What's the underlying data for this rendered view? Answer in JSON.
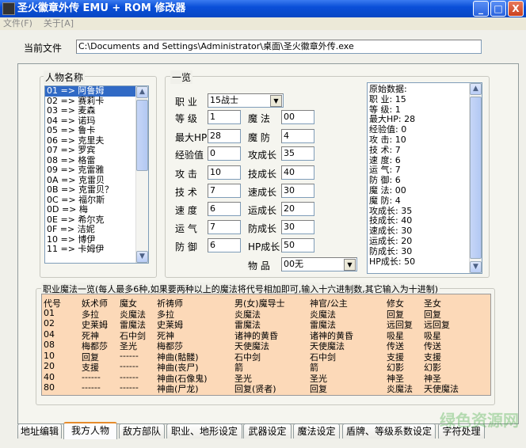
{
  "window": {
    "title": "圣火徽章外传 EMU + ROM 修改器",
    "minimize": "_",
    "maximize": "□",
    "close": "X"
  },
  "menu": [
    "文件(F)",
    "关于[A]"
  ],
  "current_file": {
    "label": "当前文件",
    "value": "C:\\Documents and Settings\\Administrator\\桌面\\圣火徽章外传.exe"
  },
  "characters": {
    "title": "人物名称",
    "items": [
      "01 => 阿鲁姆",
      "02 => 赛莉卡",
      "03 => 麦森",
      "04 => 诺玛",
      "05 => 鲁卡",
      "06 => 克里夫",
      "07 => 罗宾",
      "08 => 格雷",
      "09 => 克雷雅",
      "0A => 克雷贝",
      "0B => 克雷贝？",
      "0C => 福尔斯",
      "0D => 梅",
      "0E => 希尔克",
      "0F => 洁妮",
      "10 => 博伊",
      "11 => 卡姆伊"
    ],
    "selected": 0
  },
  "overview": {
    "title": "一览",
    "job_label": "职 业",
    "job_value": "15战士",
    "left": [
      {
        "label": "等 级",
        "value": "1"
      },
      {
        "label": "最大HP",
        "value": "28"
      },
      {
        "label": "经验值",
        "value": "0"
      },
      {
        "label": "攻 击",
        "value": "10"
      },
      {
        "label": "技 术",
        "value": "7"
      },
      {
        "label": "速 度",
        "value": "6"
      },
      {
        "label": "运 气",
        "value": "7"
      },
      {
        "label": "防 御",
        "value": "6"
      }
    ],
    "right": [
      {
        "label": "魔 法",
        "value": "00"
      },
      {
        "label": "魔 防",
        "value": "4"
      },
      {
        "label": "攻成长",
        "value": "35"
      },
      {
        "label": "技成长",
        "value": "40"
      },
      {
        "label": "速成长",
        "value": "30"
      },
      {
        "label": "运成长",
        "value": "20"
      },
      {
        "label": "防成长",
        "value": "30"
      },
      {
        "label": "HP成长",
        "value": "50"
      }
    ],
    "item_label": "物 品",
    "item_value": "00无"
  },
  "raw_data": [
    "原始数据:",
    "职 业: 15",
    "等 级: 1",
    "最大HP: 28",
    "经验值: 0",
    "攻 击: 10",
    "技 术: 7",
    "速 度: 6",
    "运 气: 7",
    "防 御: 6",
    "魔 法: 00",
    "魔 防: 4",
    "攻成长: 35",
    "技成长: 40",
    "速成长: 30",
    "运成长: 20",
    "防成长: 30",
    "HP成长: 50"
  ],
  "magic": {
    "title": "职业魔法一览(每人最多6种,如果要两种以上的魔法将代号相加即可,输入十六进制数,其它输入为十进制)",
    "rows": [
      [
        "代号",
        "妖术师",
        "魔女",
        "祈祷师",
        "男(女)魔导士",
        "神官/公主",
        "修女",
        "圣女"
      ],
      [
        "01",
        "多拉",
        "炎魔法",
        "多拉",
        "炎魔法",
        "炎魔法",
        "回复",
        "回复"
      ],
      [
        "02",
        "史莱姆",
        "雷魔法",
        "史莱姆",
        "雷魔法",
        "雷魔法",
        "远回复",
        "远回复"
      ],
      [
        "04",
        "死神",
        "石中剑",
        "死神",
        "诸神的黄昏",
        "诸神的黄昏",
        "吸星",
        "吸星"
      ],
      [
        "08",
        "梅都莎",
        "圣光",
        "梅都莎",
        "天使魔法",
        "天使魔法",
        "传送",
        "传送"
      ],
      [
        "10",
        "回复",
        "------",
        "神曲(骷髅)",
        "石中剑",
        "石中剑",
        "支援",
        "支援"
      ],
      [
        "20",
        "支援",
        "------",
        "神曲(丧尸)",
        "箭",
        "箭",
        "幻影",
        "幻影"
      ],
      [
        "40",
        "------",
        "------",
        "神曲(石像鬼)",
        "圣光",
        "圣光",
        "神圣",
        "神圣"
      ],
      [
        "80",
        "------",
        "------",
        "神曲(尸龙)",
        "回复(贤者)",
        "回复",
        "炎魔法",
        "天使魔法"
      ]
    ]
  },
  "tabs": [
    "地址编辑",
    "我方人物",
    "敌方部队",
    "职业、地形设定",
    "武器设定",
    "魔法设定",
    "盾牌、等级系数设定",
    "字符处理"
  ],
  "active_tab": 1,
  "watermark": "绿色资源网"
}
